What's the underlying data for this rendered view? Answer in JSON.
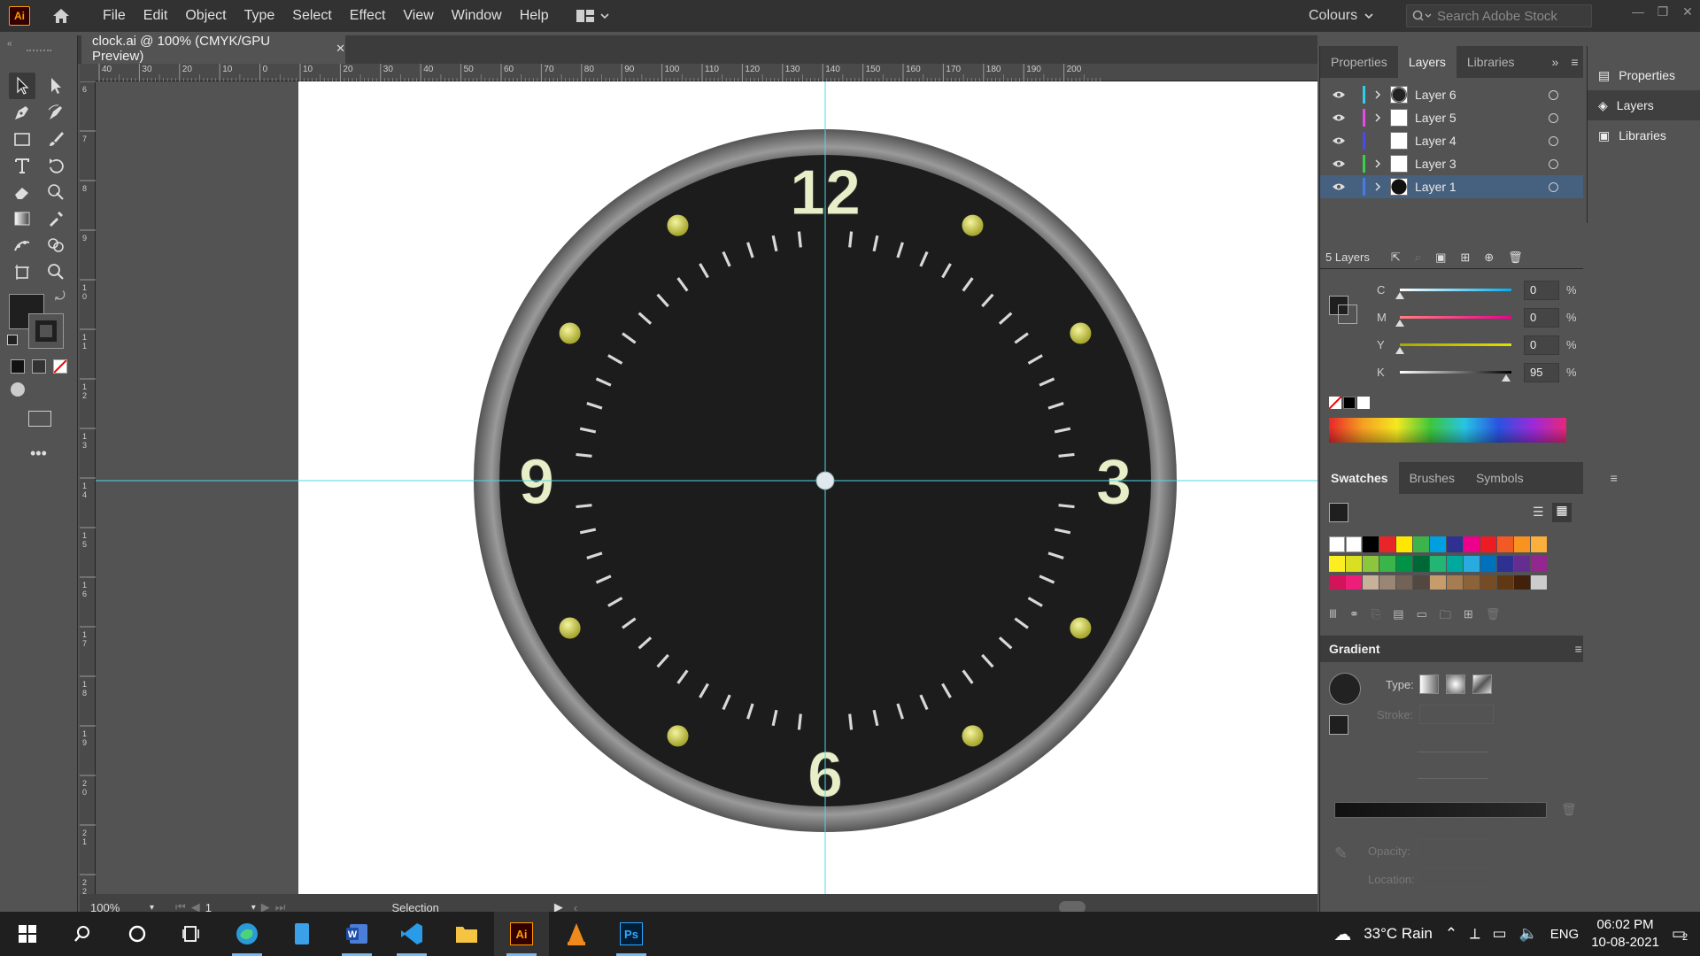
{
  "app": {
    "logo": "Ai",
    "menus": [
      "File",
      "Edit",
      "Object",
      "Type",
      "Select",
      "Effect",
      "View",
      "Window",
      "Help"
    ],
    "workspace": "Colours",
    "stock_search_placeholder": "Search Adobe Stock"
  },
  "document": {
    "tab_title": "clock.ai @ 100% (CMYK/GPU Preview)",
    "close_glyph": "✕"
  },
  "ruler": {
    "h_ticks": [
      "40",
      "30",
      "20",
      "10",
      "0",
      "10",
      "20",
      "30",
      "40",
      "50",
      "60",
      "70",
      "80",
      "90",
      "100",
      "110",
      "120",
      "130",
      "140",
      "150",
      "160",
      "170",
      "180",
      "190",
      "200"
    ],
    "v_ticks": [
      "6",
      "7",
      "8",
      "9",
      "1 0",
      "1 1",
      "1 2",
      "1 3",
      "1 4",
      "1 5",
      "1 6",
      "1 7",
      "1 8",
      "1 9",
      "2 0",
      "2 1",
      "2 2"
    ]
  },
  "clock": {
    "numerals": [
      "12",
      "3",
      "6",
      "9"
    ],
    "face_color": "#1c1c1c",
    "bezel_color": "#7a7a7a",
    "dot_color": "#c8c84a",
    "numeral_color": "#e8efc8"
  },
  "status": {
    "zoom": "100%",
    "artboard": "1",
    "tool": "Selection"
  },
  "panels": {
    "top_tabs": [
      "Properties",
      "Layers",
      "Libraries"
    ],
    "active_top_tab": "Layers",
    "layers": [
      {
        "name": "Layer 6",
        "color": "#2ed0e8",
        "expandable": true,
        "selected": false
      },
      {
        "name": "Layer 5",
        "color": "#e84ae8",
        "expandable": true,
        "selected": false
      },
      {
        "name": "Layer 4",
        "color": "#4a4ae8",
        "expandable": false,
        "selected": false
      },
      {
        "name": "Layer 3",
        "color": "#3ad04a",
        "expandable": true,
        "selected": false
      },
      {
        "name": "Layer 1",
        "color": "#4a7ae8",
        "expandable": true,
        "selected": true
      }
    ],
    "layer_count": "5 Layers",
    "color": {
      "channels": [
        {
          "label": "C",
          "value": "0"
        },
        {
          "label": "M",
          "value": "0"
        },
        {
          "label": "Y",
          "value": "0"
        },
        {
          "label": "K",
          "value": "95"
        }
      ],
      "percent": "%"
    },
    "swatch_tabs": [
      "Swatches",
      "Brushes",
      "Symbols"
    ],
    "gradient": {
      "title": "Gradient",
      "type_label": "Type:",
      "stroke_label": "Stroke:",
      "opacity_label": "Opacity:",
      "location_label": "Location:"
    }
  },
  "dock": [
    "Properties",
    "Layers",
    "Libraries"
  ],
  "taskbar": {
    "weather": "33°C  Rain",
    "lang": "ENG",
    "time": "06:02 PM",
    "date": "10-08-2021",
    "notifications": "2"
  }
}
